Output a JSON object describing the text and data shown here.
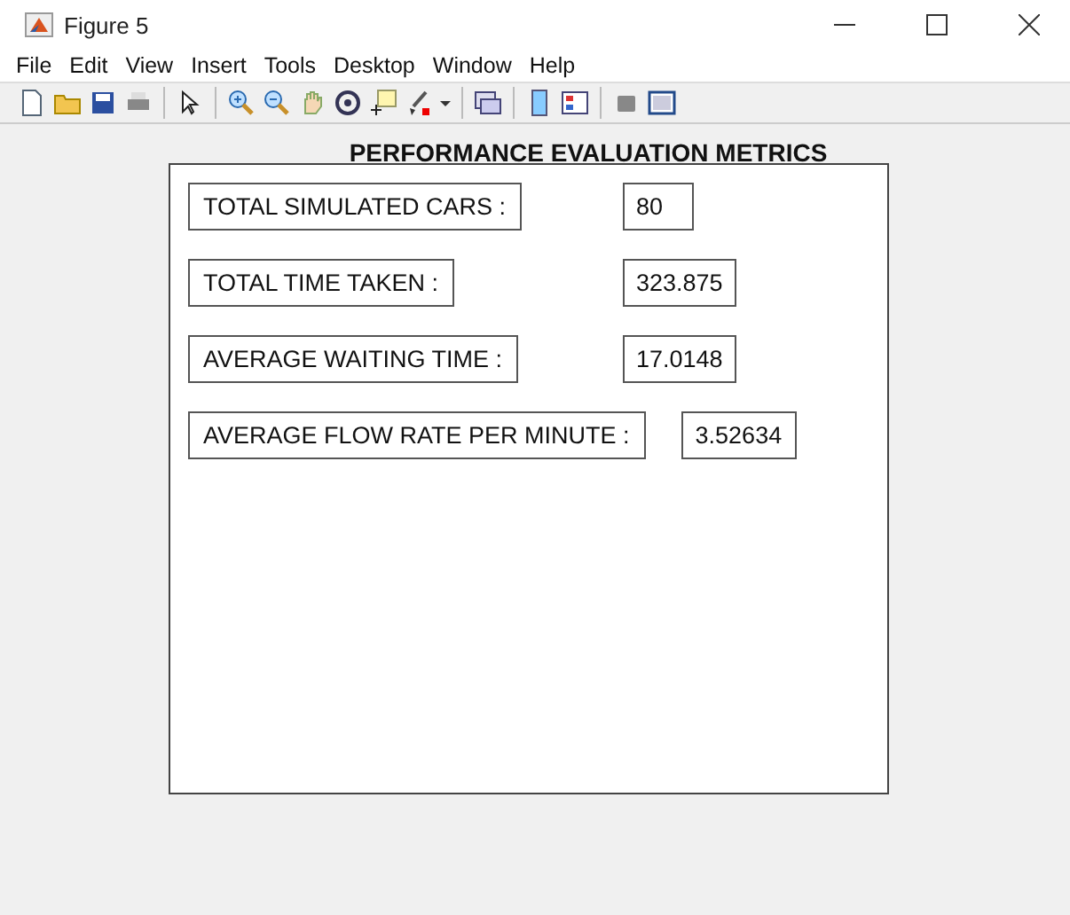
{
  "window": {
    "title": "Figure 5"
  },
  "menu": [
    "File",
    "Edit",
    "View",
    "Insert",
    "Tools",
    "Desktop",
    "Window",
    "Help"
  ],
  "panel": {
    "title": "PERFORMANCE EVALUATION METRICS",
    "rows": [
      {
        "label": "TOTAL SIMULATED CARS :",
        "value": "80"
      },
      {
        "label": "TOTAL TIME TAKEN :",
        "value": "323.875"
      },
      {
        "label": "AVERAGE WAITING TIME :",
        "value": "17.0148"
      },
      {
        "label": "AVERAGE FLOW RATE PER MINUTE :",
        "value": "3.52634"
      }
    ]
  }
}
